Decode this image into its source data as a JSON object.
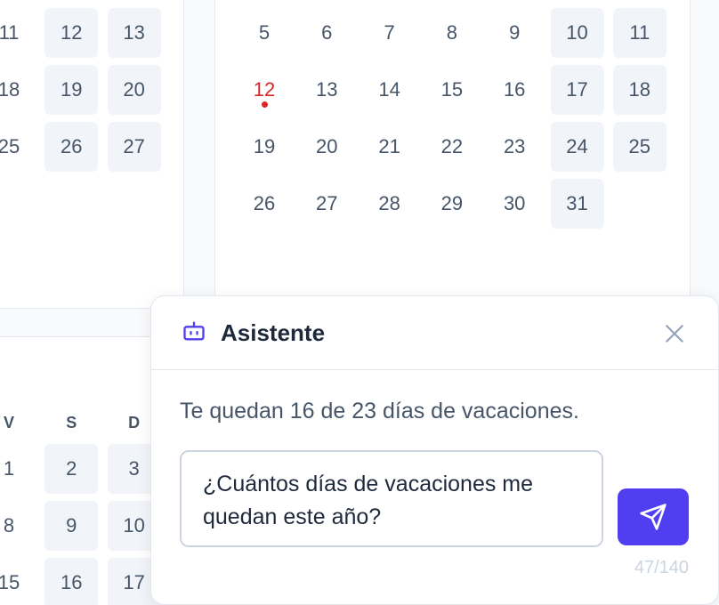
{
  "calendar_left_top": {
    "rows": [
      [
        {
          "d": "11"
        },
        {
          "d": "12",
          "w": true
        },
        {
          "d": "13",
          "w": true
        }
      ],
      [
        {
          "d": "18"
        },
        {
          "d": "19",
          "w": true
        },
        {
          "d": "20",
          "w": true
        }
      ],
      [
        {
          "d": "25"
        },
        {
          "d": "26",
          "w": true
        },
        {
          "d": "27",
          "w": true
        }
      ]
    ]
  },
  "calendar_right_top": {
    "rows": [
      [
        {
          "d": "5"
        },
        {
          "d": "6"
        },
        {
          "d": "7"
        },
        {
          "d": "8"
        },
        {
          "d": "9"
        },
        {
          "d": "10",
          "w": true
        },
        {
          "d": "11",
          "w": true
        }
      ],
      [
        {
          "d": "12",
          "today": true
        },
        {
          "d": "13"
        },
        {
          "d": "14"
        },
        {
          "d": "15"
        },
        {
          "d": "16"
        },
        {
          "d": "17",
          "w": true
        },
        {
          "d": "18",
          "w": true
        }
      ],
      [
        {
          "d": "19"
        },
        {
          "d": "20"
        },
        {
          "d": "21"
        },
        {
          "d": "22"
        },
        {
          "d": "23"
        },
        {
          "d": "24",
          "w": true
        },
        {
          "d": "25",
          "w": true
        }
      ],
      [
        {
          "d": "26"
        },
        {
          "d": "27"
        },
        {
          "d": "28"
        },
        {
          "d": "29"
        },
        {
          "d": "30"
        },
        {
          "d": "31",
          "w": true
        }
      ]
    ]
  },
  "calendar_left_bottom": {
    "weekdays": [
      "V",
      "S",
      "D"
    ],
    "rows": [
      [
        {
          "d": "1"
        },
        {
          "d": "2",
          "w": true
        },
        {
          "d": "3",
          "w": true
        }
      ],
      [
        {
          "d": "8"
        },
        {
          "d": "9",
          "w": true
        },
        {
          "d": "10",
          "w": true
        }
      ],
      [
        {
          "d": "15"
        },
        {
          "d": "16",
          "w": true
        },
        {
          "d": "17",
          "w": true
        }
      ]
    ]
  },
  "assistant": {
    "title": "Asistente",
    "reply": "Te quedan 16 de 23 días de vacaciones.",
    "question": "¿Cuántos días de vacaciones me quedan este año?",
    "counter": "47/140",
    "colors": {
      "accent": "#4f3ff0",
      "today": "#dc2626"
    }
  }
}
